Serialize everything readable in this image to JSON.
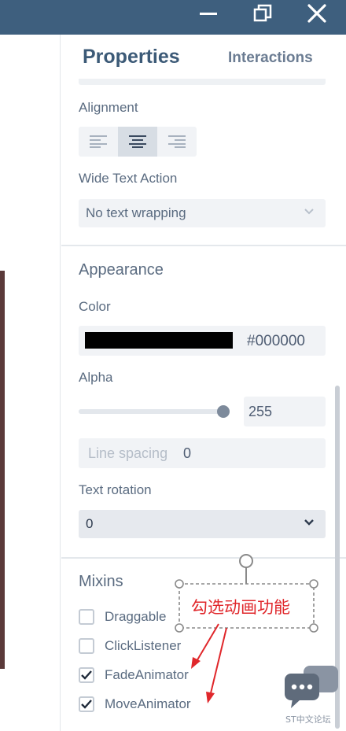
{
  "window": {
    "controls": [
      "minimize-icon",
      "restore-icon",
      "close-icon"
    ]
  },
  "panel": {
    "tabs": {
      "properties": "Properties",
      "interactions": "Interactions"
    },
    "alignment": {
      "label": "Alignment",
      "options": [
        "align-left-icon",
        "align-center-icon",
        "align-right-icon"
      ],
      "selected": "align-center-icon"
    },
    "wide_text": {
      "label": "Wide Text Action",
      "value": "No text wrapping"
    },
    "appearance": {
      "title": "Appearance",
      "color_label": "Color",
      "color_value": "#000000",
      "swatch_color": "#000000",
      "alpha_label": "Alpha",
      "alpha_value": "255",
      "alpha_fraction": 1.0,
      "line_spacing_label": "Line spacing",
      "line_spacing_value": "0",
      "rotation_label": "Text rotation",
      "rotation_value": "0"
    },
    "mixins": {
      "title": "Mixins",
      "items": [
        {
          "label": "Draggable",
          "checked": false
        },
        {
          "label": "ClickListener",
          "checked": false
        },
        {
          "label": "FadeAnimator",
          "checked": true
        },
        {
          "label": "MoveAnimator",
          "checked": true
        }
      ]
    }
  },
  "annotation": {
    "text": "勾选动画功能",
    "color": "#e0272b"
  },
  "watermark": {
    "text": "ST中文论坛",
    "icon": "chat-bubbles-icon"
  },
  "colors": {
    "titlebar": "#3e5f7e",
    "accent": "#3c5a77",
    "text": "#5a6b80"
  }
}
